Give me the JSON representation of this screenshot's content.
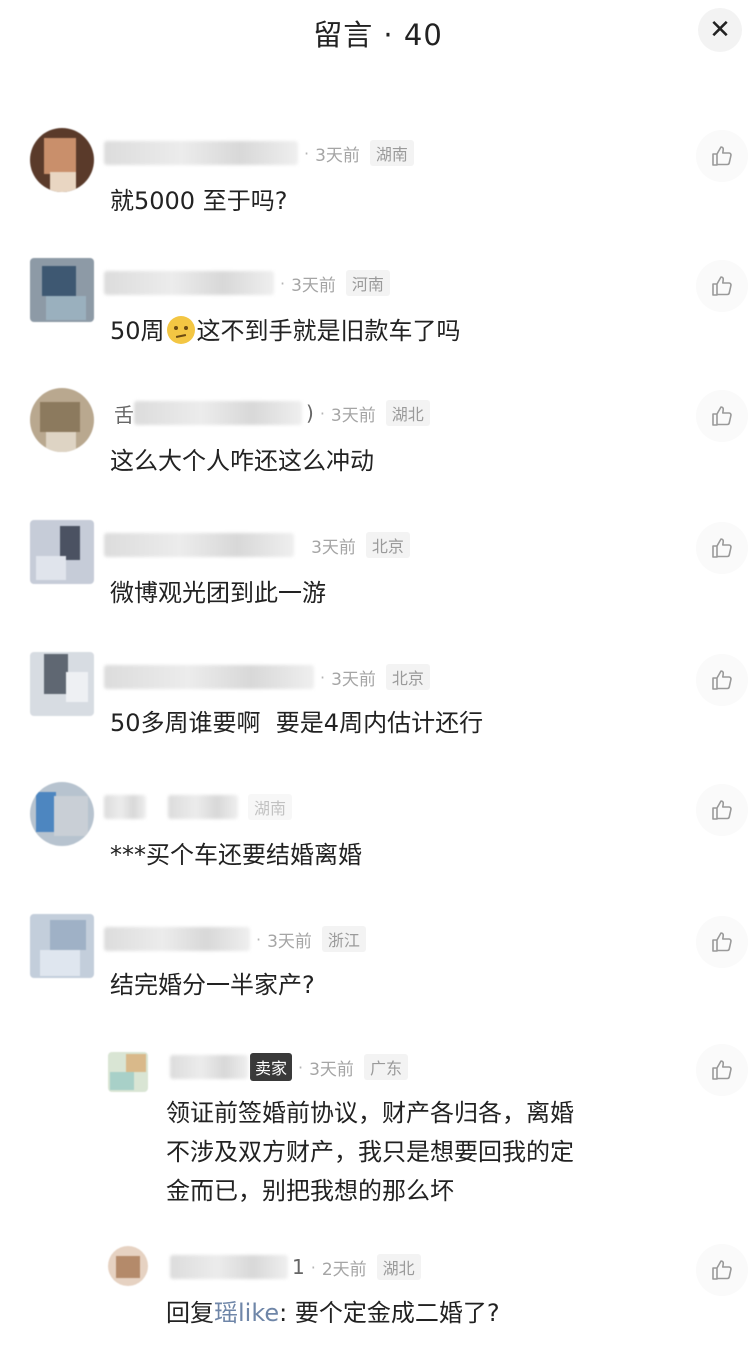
{
  "header": {
    "title": "留言 · 40",
    "close_glyph": "✕"
  },
  "icons": {
    "like": "thumbs-up-icon",
    "close": "close-icon"
  },
  "comments": [
    {
      "time": "3天前",
      "location": "湖南",
      "text": "就5000 至于吗?"
    },
    {
      "time": "3天前",
      "location": "河南",
      "text_before": "50周",
      "emoji": "thinking-face-emoji",
      "text_after": "这不到手就是旧款车了吗"
    },
    {
      "time": "3天前",
      "location": "湖北",
      "name_prefix": "舌",
      "name_suffix": ")",
      "text": "这么大个人咋还这么冲动"
    },
    {
      "time": "3天前",
      "location": "北京",
      "text": "微博观光团到此一游"
    },
    {
      "time": "3天前",
      "location": "北京",
      "text": "50多周谁要啊  要是4周内估计还行"
    },
    {
      "location": "湖南",
      "text": "***买个车还要结婚离婚"
    },
    {
      "time": "3天前",
      "location": "浙江",
      "text": "结完婚分一半家产?"
    },
    {
      "time": "3天前",
      "location": "广东",
      "badge": "卖家",
      "line1": "领证前签婚前协议，财产各归各，离婚",
      "line2": "不涉及双方财产，我只是想要回我的定",
      "line3": "金而已，别把我想的那么坏"
    },
    {
      "time": "2天前",
      "location": "湖北",
      "name_suffix": "1",
      "reply_prefix": "回复",
      "reply_name": "瑶like",
      "reply_text": ": 要个定金成二婚了?"
    }
  ]
}
